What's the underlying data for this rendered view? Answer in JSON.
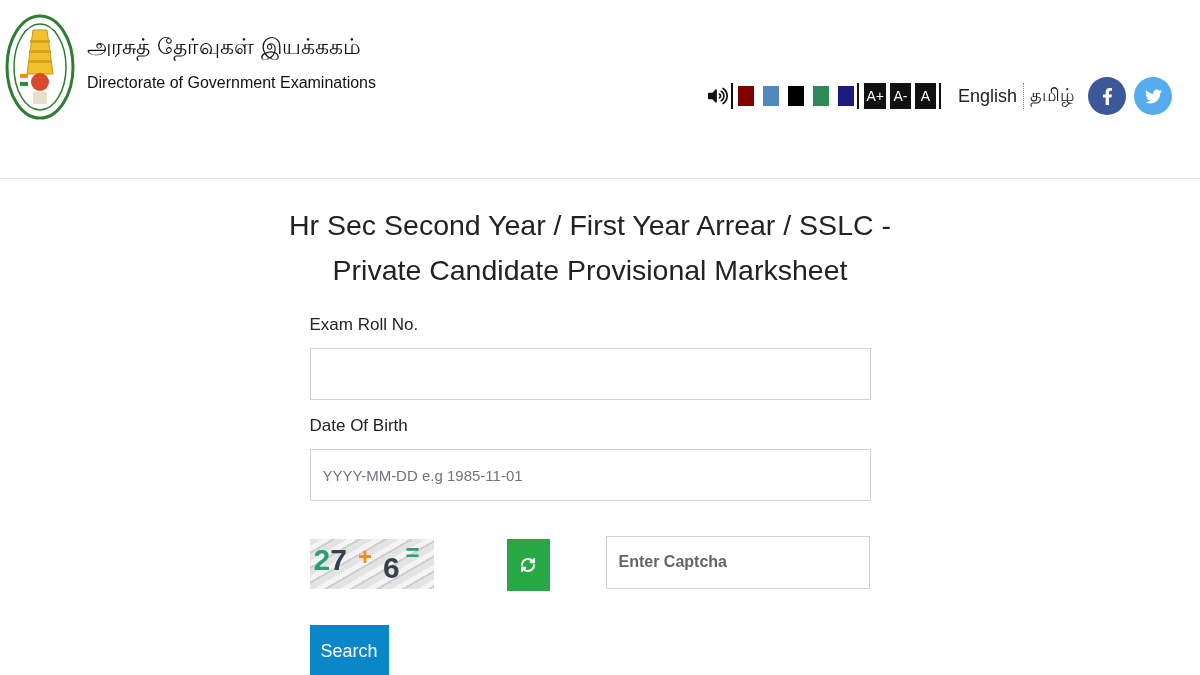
{
  "header": {
    "title_tamil": "அரசுத் தேர்வுகள் இயக்ககம்",
    "title_english": "Directorate of Government Examinations"
  },
  "toolbar": {
    "theme_colors": [
      {
        "color": "#800000"
      },
      {
        "color": "#4f89bd"
      },
      {
        "color": "#000000"
      },
      {
        "color": "#2e8b57"
      },
      {
        "color": "#1a1a80"
      }
    ],
    "font_sizes": [
      "A+",
      "A-",
      "A"
    ],
    "languages": [
      "English",
      "தமிழ்"
    ],
    "social": [
      {
        "kind": "facebook",
        "color": "#3b5998"
      },
      {
        "kind": "twitter",
        "color": "#55acee"
      }
    ]
  },
  "form": {
    "title_lines": [
      "Hr Sec Second Year / First Year Arrear / SSLC -",
      "Private Candidate Provisional Marksheet"
    ],
    "fields": [
      {
        "label": "Exam Roll No."
      },
      {
        "label": "Date Of Birth",
        "placeholder": "YYYY-MM-DD e.g 1985-11-01"
      }
    ],
    "captcha": {
      "tokens": [
        {
          "text": "2",
          "color": "#2a9d78"
        },
        {
          "text": "7",
          "color": "#34404f"
        },
        {
          "text": "+",
          "color": "#f0891a"
        },
        {
          "text": "6",
          "color": "#34404f"
        },
        {
          "text": "=",
          "color": "#2a9d78"
        }
      ],
      "placeholder": "Enter Captcha"
    },
    "submit": "Search"
  }
}
